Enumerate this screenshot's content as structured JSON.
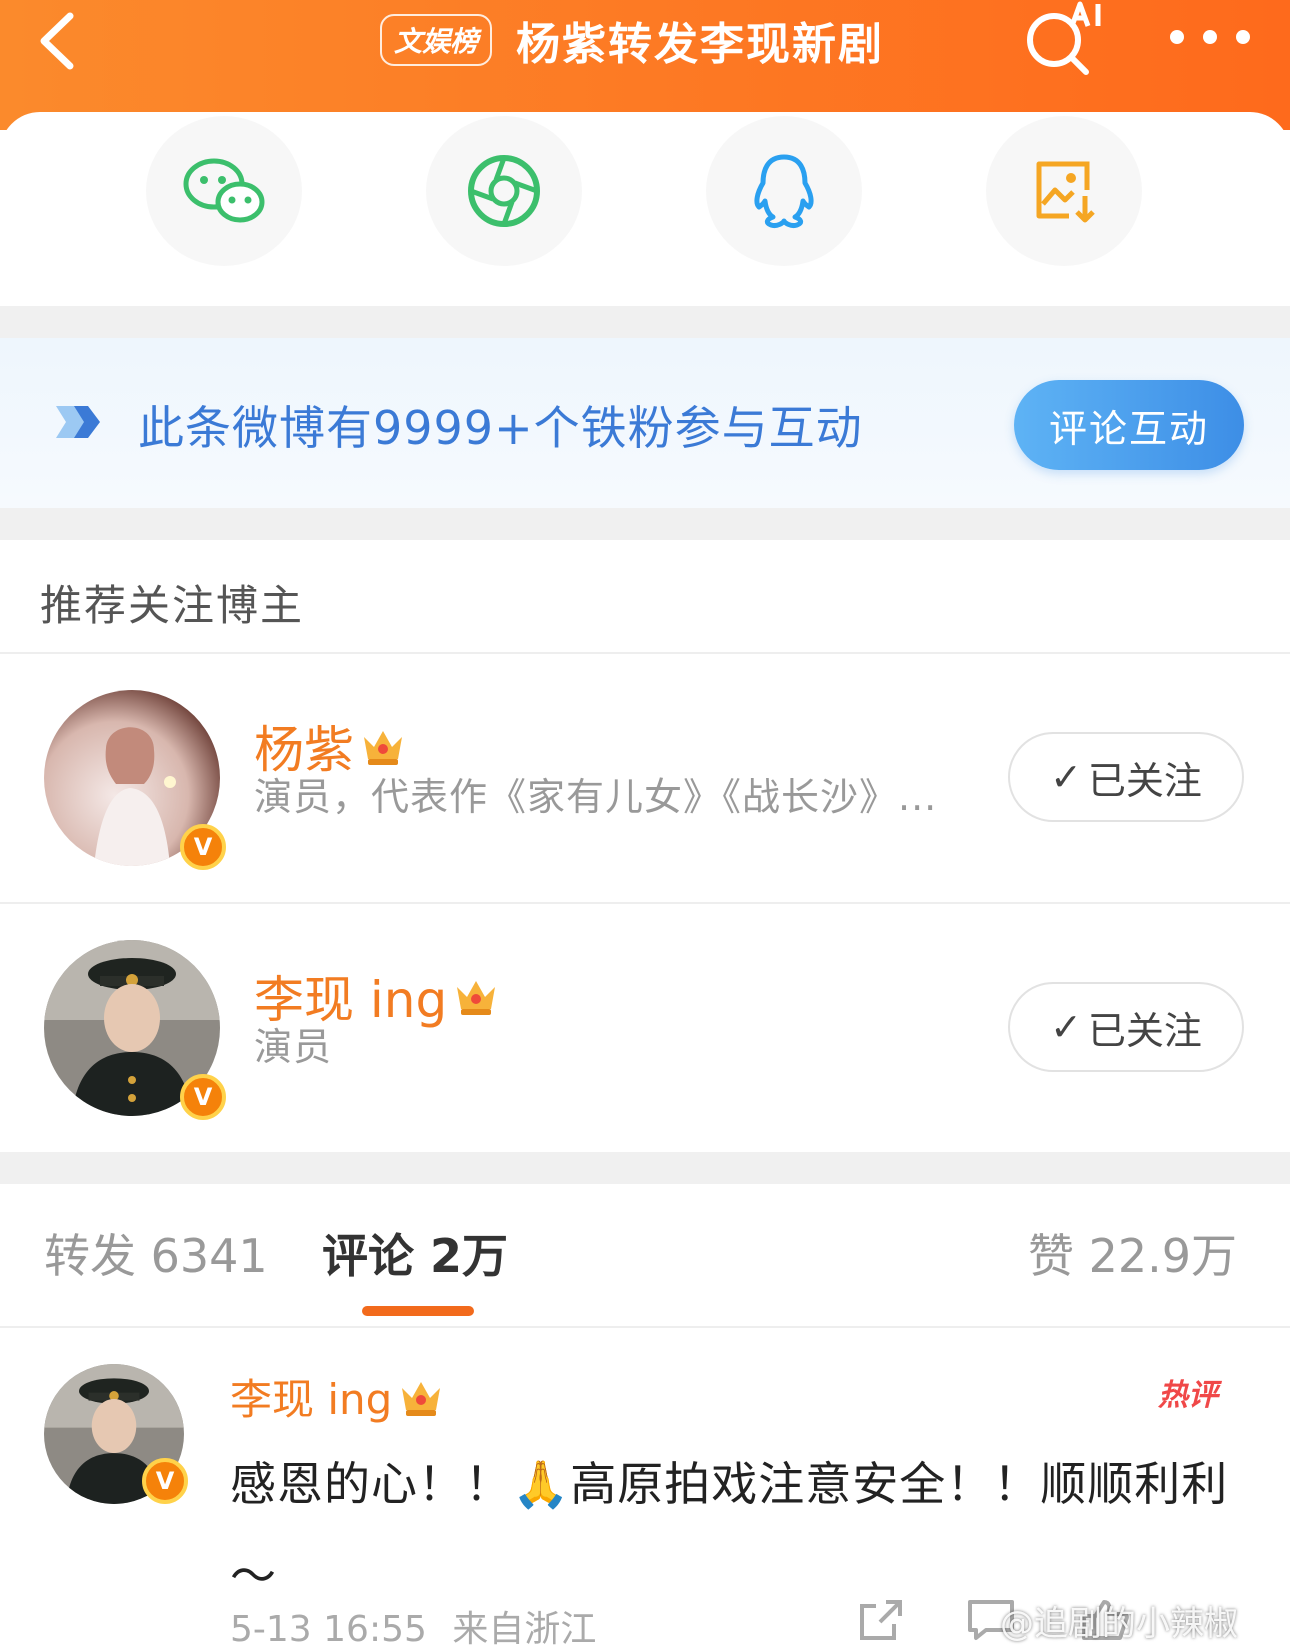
{
  "header": {
    "badge": "文娱榜",
    "title": "杨紫转发李现新剧"
  },
  "share": {
    "items": [
      {
        "icon": "wechat-icon"
      },
      {
        "icon": "moments-icon"
      },
      {
        "icon": "qq-icon"
      },
      {
        "icon": "save-image-icon"
      }
    ]
  },
  "banner": {
    "text": "此条微博有9999+个铁粉参与互动",
    "button": "评论互动"
  },
  "recommend": {
    "title": "推荐关注博主",
    "users": [
      {
        "name": "杨紫",
        "desc": "演员，代表作《家有儿女》《战长沙》...",
        "follow": "已关注",
        "check": "✓"
      },
      {
        "name": "李现 ing",
        "desc": "演员",
        "follow": "已关注",
        "check": "✓"
      }
    ]
  },
  "tabs": {
    "repost": "转发 6341",
    "comment": "评论 2万",
    "like": "赞 22.9万"
  },
  "comment": {
    "user": "李现 ing",
    "hot_label": "热评",
    "text": "感恩的心！！🙏高原拍戏注意安全！！顺顺利利～",
    "time": "5-13 16:55",
    "location": "来自浙江"
  },
  "watermark": "@追剧的小辣椒",
  "colors": {
    "header_orange": "#fd7a24",
    "name_orange": "#f27c22",
    "banner_blue": "#3d8ee6",
    "tab_underline": "#f26a1c"
  }
}
